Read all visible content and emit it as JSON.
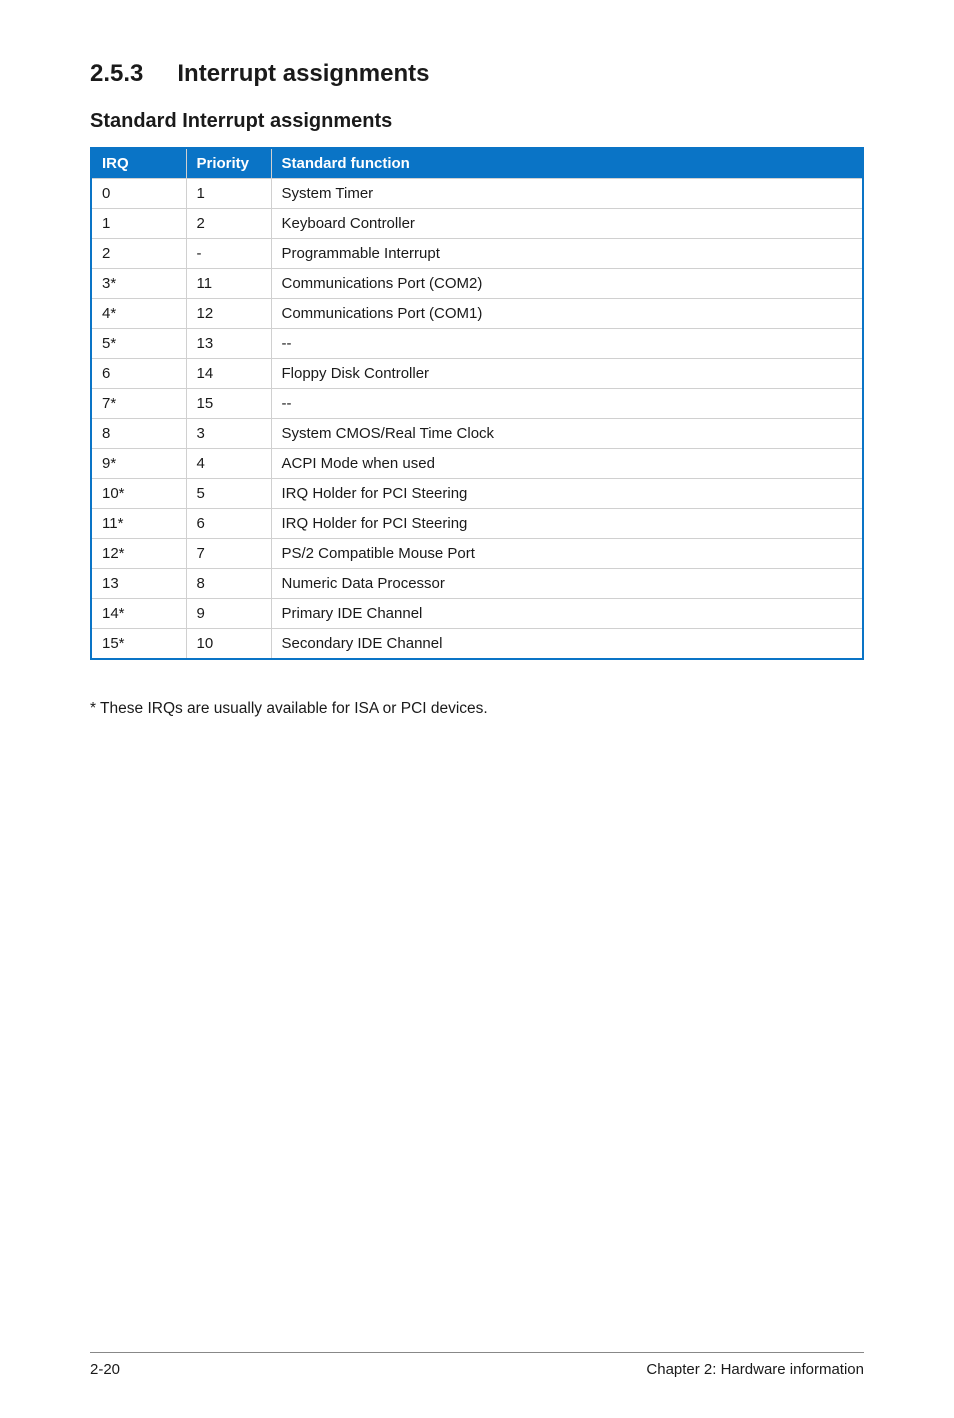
{
  "section": {
    "number": "2.5.3",
    "title": "Interrupt assignments"
  },
  "subhead": "Standard Interrupt assignments",
  "table": {
    "headers": {
      "irq": "IRQ",
      "priority": "Priority",
      "func": "Standard function"
    },
    "rows": [
      {
        "irq": "0",
        "priority": "1",
        "func": "System Timer"
      },
      {
        "irq": "1",
        "priority": "2",
        "func": "Keyboard Controller"
      },
      {
        "irq": "2",
        "priority": "-",
        "func": "Programmable Interrupt"
      },
      {
        "irq": "3*",
        "priority": "11",
        "func": "Communications Port (COM2)"
      },
      {
        "irq": "4*",
        "priority": "12",
        "func": "Communications Port (COM1)"
      },
      {
        "irq": "5*",
        "priority": "13",
        "func": "--"
      },
      {
        "irq": "6",
        "priority": "14",
        "func": "Floppy Disk Controller"
      },
      {
        "irq": "7*",
        "priority": "15",
        "func": "--"
      },
      {
        "irq": "8",
        "priority": "3",
        "func": "System CMOS/Real Time Clock"
      },
      {
        "irq": "9*",
        "priority": "4",
        "func": "ACPI Mode when used"
      },
      {
        "irq": "10*",
        "priority": "5",
        "func": "IRQ Holder for PCI Steering"
      },
      {
        "irq": "11*",
        "priority": "6",
        "func": "IRQ Holder for PCI Steering"
      },
      {
        "irq": "12*",
        "priority": "7",
        "func": "PS/2 Compatible Mouse Port"
      },
      {
        "irq": "13",
        "priority": "8",
        "func": "Numeric Data Processor"
      },
      {
        "irq": "14*",
        "priority": "9",
        "func": "Primary IDE Channel"
      },
      {
        "irq": "15*",
        "priority": "10",
        "func": "Secondary IDE Channel"
      }
    ]
  },
  "footnote": "* These IRQs are usually available for ISA or PCI devices.",
  "footer": {
    "page": "2-20",
    "chapter": "Chapter 2: Hardware information"
  }
}
